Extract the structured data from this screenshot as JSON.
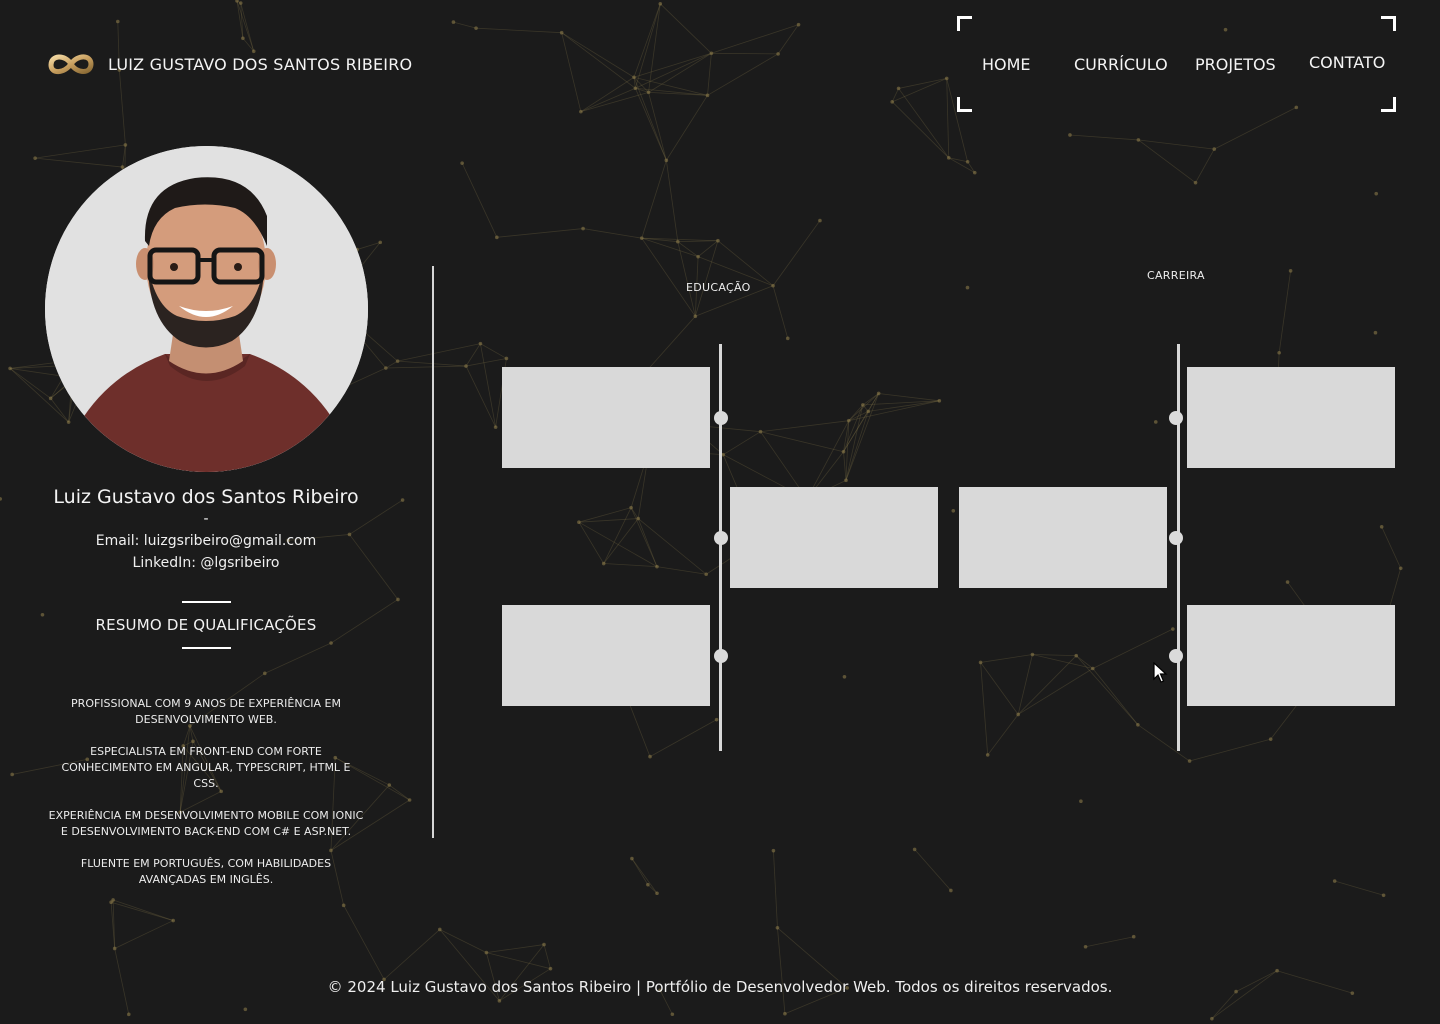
{
  "header": {
    "brand_name": "LUIZ GUSTAVO DOS SANTOS RIBEIRO",
    "logo_icon": "infinity-icon",
    "nav": [
      {
        "label": "HOME"
      },
      {
        "label": "CURRÍCULO"
      },
      {
        "label": "PROJETOS"
      },
      {
        "label": "CONTATO"
      }
    ]
  },
  "profile": {
    "name": "Luiz Gustavo dos Santos Ribeiro",
    "dash": "-",
    "email": "Email: luizgsribeiro@gmail.com",
    "linkedin": "LinkedIn: @lgsribeiro",
    "avatar_icon": "profile-photo"
  },
  "qualifications": {
    "title": "RESUMO DE QUALIFICAÇÕES",
    "items": [
      "PROFISSIONAL COM 9 ANOS DE EXPERIÊNCIA EM DESENVOLVIMENTO WEB.",
      "ESPECIALISTA EM FRONT-END COM FORTE CONHECIMENTO EM ANGULAR, TYPESCRIPT, HTML E CSS.",
      "EXPERIÊNCIA EM DESENVOLVIMENTO MOBILE COM IONIC E DESENVOLVIMENTO BACK-END COM C# E ASP.NET.",
      "FLUENTE EM PORTUGUÊS, COM HABILIDADES AVANÇADAS EM INGLÊS."
    ]
  },
  "timeline": {
    "education_title": "EDUCAÇÃO",
    "career_title": "CARREIRA"
  },
  "footer": {
    "text": "© 2024 Luiz Gustavo dos Santos Ribeiro | Portfólio de Desenvolvedor Web. Todos os direitos reservados."
  },
  "colors": {
    "background": "#1b1b1b",
    "text": "#f4f4f4",
    "card": "#d9d9d9",
    "network_dots": "#8a7a4a"
  }
}
